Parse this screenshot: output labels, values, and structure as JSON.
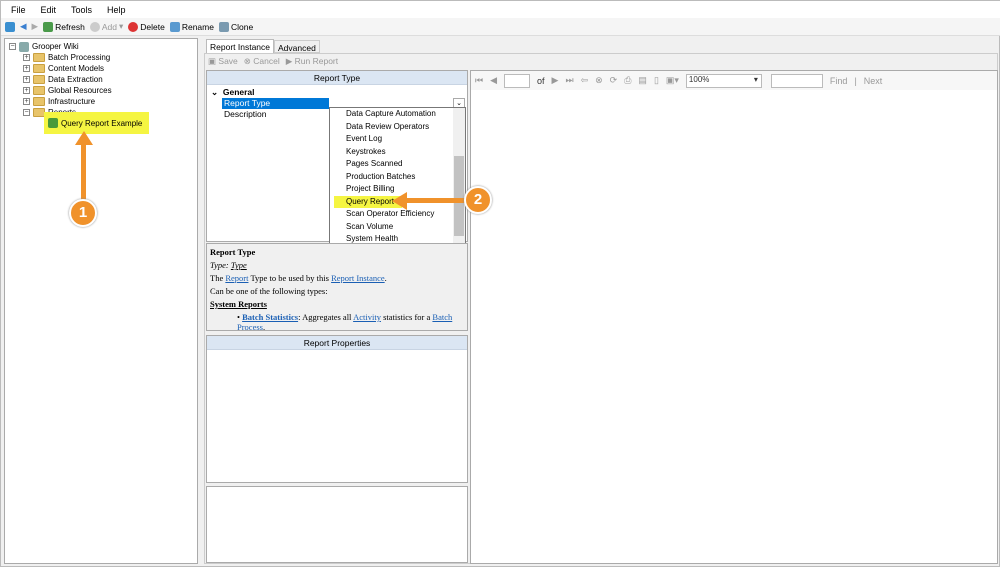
{
  "menu": [
    "File",
    "Edit",
    "Tools",
    "Help"
  ],
  "toolbar": {
    "refresh": "Refresh",
    "add": "Add",
    "delete": "Delete",
    "rename": "Rename",
    "clone": "Clone"
  },
  "tree": {
    "root": "Grooper Wiki",
    "items": [
      "Batch Processing",
      "Content Models",
      "Data Extraction",
      "Global Resources",
      "Infrastructure",
      "Reports"
    ],
    "child": "Query Report Example"
  },
  "tabs": [
    "Report Instance",
    "Advanced"
  ],
  "actions": {
    "save": "Save",
    "cancel": "Cancel",
    "run": "Run Report"
  },
  "propgrid": {
    "header": "Report Type",
    "category": "General",
    "props": [
      "Report Type",
      "Description"
    ]
  },
  "dropdown": [
    "Data Capture Automation",
    "Data Review Operators",
    "Event Log",
    "Keystrokes",
    "Pages Scanned",
    "Production Batches",
    "Project Billing",
    "Query Report",
    "Scan Operator Efficiency",
    "Scan Volume",
    "System Health"
  ],
  "help": {
    "title": "Report Type",
    "type_label": "Type:",
    "type_value": "Type",
    "l1a": "The ",
    "l1b": "Report",
    "l1c": " Type to be used by this ",
    "l1d": "Report Instance",
    "l1e": ".",
    "l2": "Can be one of the following types:",
    "section": "System Reports",
    "b1a": "Batch Statistics",
    "b1b": ": Aggregates all ",
    "b1c": "Activity",
    "b1d": " statistics for a ",
    "b1e": "Batch Process",
    "b1f": "."
  },
  "report_properties": "Report Properties",
  "viewer": {
    "of": "of",
    "zoom": "100%",
    "find": "Find",
    "next": "Next"
  },
  "callouts": [
    "1",
    "2"
  ],
  "colors": {
    "highlight": "#f5f542",
    "callout": "#f0922b",
    "selection": "#0078d7"
  }
}
